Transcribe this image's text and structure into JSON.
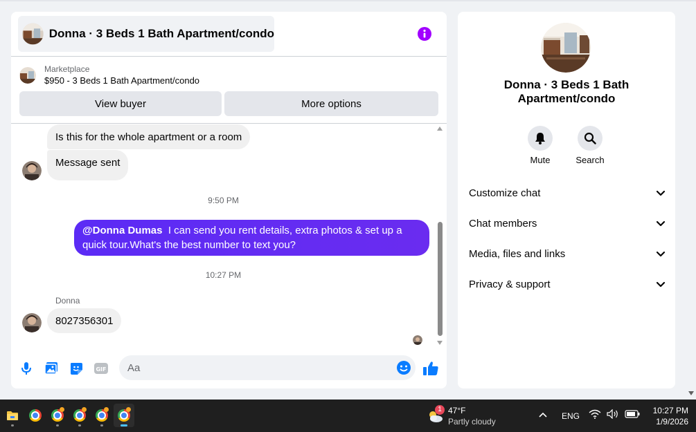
{
  "chat": {
    "title": "Donna · 3 Beds 1 Bath Apartment/condo",
    "marketplace_label": "Marketplace",
    "marketplace_listing": "$950 - 3 Beds 1 Bath Apartment/condo",
    "view_buyer_label": "View buyer",
    "more_options_label": "More options"
  },
  "messages": {
    "incoming_1": "Is this for the whole apartment or a room",
    "incoming_2": "Message sent",
    "timestamp_1": "9:50 PM",
    "outgoing_mention": "@Donna Dumas",
    "outgoing_text": "I can send you rent details, extra photos & set up a quick tour.What's the best number to text you?",
    "timestamp_2": "10:27 PM",
    "sender_name": "Donna",
    "incoming_3": "8027356301"
  },
  "composer": {
    "placeholder": "Aa"
  },
  "info": {
    "name": "Donna · 3 Beds 1 Bath Apartment/condo",
    "mute_label": "Mute",
    "search_label": "Search",
    "sections": [
      "Customize chat",
      "Chat members",
      "Media, files and links",
      "Privacy & support"
    ]
  },
  "taskbar": {
    "temperature": "47°F",
    "condition": "Partly cloudy",
    "weather_badge": "1",
    "language": "ENG",
    "time": "10:27 PM",
    "date": "1/9/2026"
  },
  "colors": {
    "accent_purple": "#a100ff",
    "outgoing_bubble": "#5b2bf5",
    "messenger_blue": "#0a7cff",
    "taskbar_bg": "#1f1f1f"
  }
}
